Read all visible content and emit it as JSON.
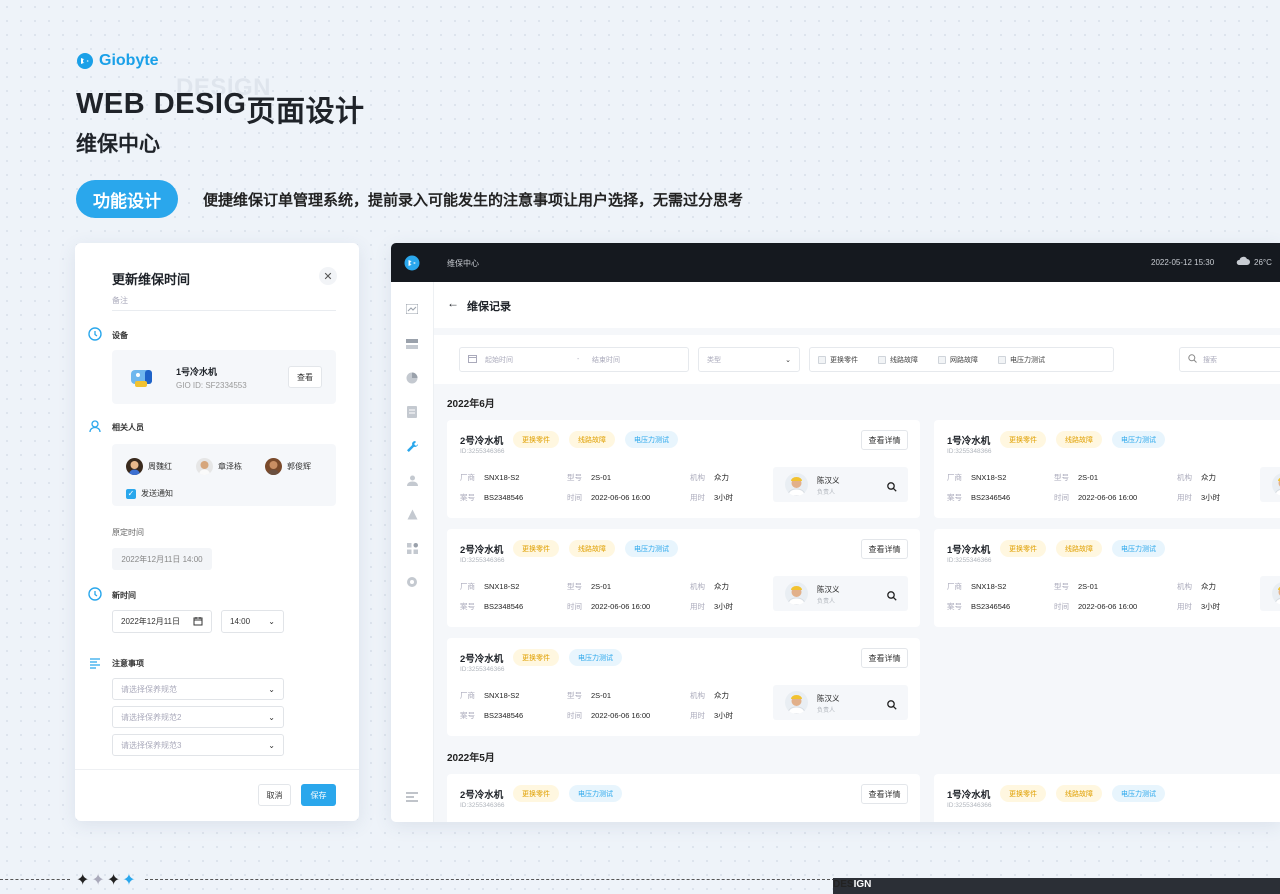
{
  "brand": {
    "name": "Giobyte"
  },
  "heading": {
    "title_en": "WEB DESIG",
    "title_cn": "页面设计",
    "ghost": "DESIGN",
    "subtitle": "维保中心"
  },
  "feature": {
    "pill": "功能设计",
    "desc": "便捷维保订单管理系统，提前录入可能发生的注意事项让用户选择，无需过分思考"
  },
  "modal": {
    "title": "更新维保时间",
    "close": "✕",
    "note": "备注",
    "device_label": "设备",
    "device_name": "1号冷水机",
    "device_id": "GIO ID:  SF2334553",
    "view": "查看",
    "people_label": "相关人员",
    "people": [
      {
        "name": "周魏红"
      },
      {
        "name": "章泽栋"
      },
      {
        "name": "郭俊辉"
      }
    ],
    "notify": "发送通知",
    "old_time_label": "原定时间",
    "old_time": "2022年12月11日  14:00",
    "new_time_label": "新时间",
    "new_date": "2022年12月11日",
    "new_hour": "14:00",
    "notes_label": "注意事项",
    "selects": [
      "请选择保养规范",
      "请选择保养规范2",
      "请选择保养规范3"
    ],
    "cancel": "取消",
    "save": "保存"
  },
  "app": {
    "top_title": "维保中心",
    "datetime": "2022-05-12  15:30",
    "temp": "26°C",
    "page_title": "维保记录",
    "back": "←",
    "filters": {
      "start": "起始时间",
      "dash": "-",
      "end": "结束时间",
      "type": "类型",
      "search": "搜索",
      "checks": [
        "更换零件",
        "线路故障",
        "网路故障",
        "电压力测试"
      ]
    },
    "labels": {
      "vendor": "厂商",
      "model": "型号",
      "org": "机构",
      "case": "案号",
      "time": "时间",
      "duration": "用时",
      "owner_role": "负责人",
      "detail": "查看详情"
    },
    "months": [
      "2022年6月",
      "2022年5月"
    ],
    "cards": [
      {
        "name": "2号冷水机",
        "id": "ID:3255346366",
        "tags": [
          "更换零件",
          "线路故障",
          "电压力测试"
        ],
        "vendor": "SNX18-S2",
        "model": "2S-01",
        "org": "众力",
        "case": "BS2348546",
        "time": "2022-06-06  16:00",
        "duration": "3小时",
        "owner": "陈汉义"
      },
      {
        "name": "1号冷水机",
        "id": "ID:3255348366",
        "tags": [
          "更换零件",
          "线路故障",
          "电压力测试"
        ],
        "vendor": "SNX18-S2",
        "model": "2S-01",
        "org": "众力",
        "case": "BS2346546",
        "time": "2022-06-06  16:00",
        "duration": "3小时",
        "owner": "陈汉义"
      },
      {
        "name": "2号冷水机",
        "id": "ID:3255346366",
        "tags": [
          "更换零件",
          "线路故障",
          "电压力测试"
        ],
        "vendor": "SNX18-S2",
        "model": "2S-01",
        "org": "众力",
        "case": "BS2348546",
        "time": "2022-06-06  16:00",
        "duration": "3小时",
        "owner": "陈汉义"
      },
      {
        "name": "1号冷水机",
        "id": "ID:3255346366",
        "tags": [
          "更换零件",
          "线路故障",
          "电压力测试"
        ],
        "vendor": "SNX18-S2",
        "model": "2S-01",
        "org": "众力",
        "case": "BS2346546",
        "time": "2022-06-06  16:00",
        "duration": "3小时",
        "owner": "陈汉义"
      },
      {
        "name": "2号冷水机",
        "id": "ID:3255346366",
        "tags": [
          "更换零件",
          "电压力测试"
        ],
        "vendor": "SNX18-S2",
        "model": "2S-01",
        "org": "众力",
        "case": "BS2348546",
        "time": "2022-06-06  16:00",
        "duration": "3小时",
        "owner": "陈汉义"
      },
      {
        "name": "2号冷水机",
        "id": "ID:3255346366",
        "tags": [
          "更换零件",
          "电压力测试"
        ]
      },
      {
        "name": "1号冷水机",
        "id": "ID:3255346366",
        "tags": [
          "更换零件",
          "线路故障",
          "电压力测试"
        ]
      }
    ]
  },
  "footer": {
    "design_left": "DES",
    "design_right": "IGN",
    "stars": "✦✦✦✦"
  },
  "colors": {
    "accent": "#2aa7ec",
    "topbar": "#15191f",
    "tag_yellow": "#e0a000"
  }
}
